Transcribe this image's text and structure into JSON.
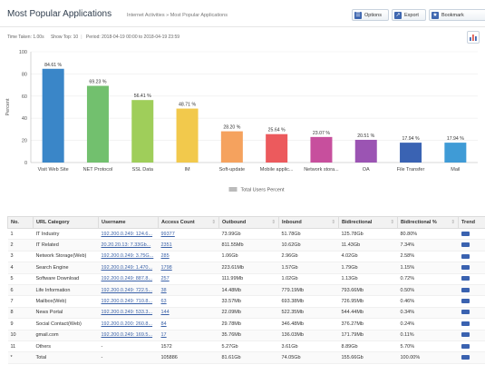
{
  "header": {
    "title": "Most Popular Applications",
    "breadcrumb": "Internet Activities » Most Popular Applications",
    "buttons": {
      "options": "Options",
      "export": "Export",
      "bookmark": "Bookmark"
    }
  },
  "info": {
    "time_taken": "Time Taken: 1.00s",
    "show_top": "Show Top: 10",
    "period": "Period: 2018-04-19 00:00 to 2018-04-19 23:59"
  },
  "chart_data": {
    "type": "bar",
    "ylabel": "Percent",
    "xlabel": "",
    "ylim": [
      0,
      100
    ],
    "yticks": [
      0,
      20,
      40,
      60,
      80,
      100
    ],
    "categories": [
      "Visit Web Site",
      "NET Protocol",
      "SSL Data",
      "IM",
      "Soft-update",
      "Mobile applic...",
      "Network stora...",
      "OA",
      "File Transfer",
      "Mail"
    ],
    "values": [
      84.61,
      69.23,
      56.41,
      48.71,
      28.2,
      25.64,
      23.07,
      20.51,
      17.94,
      17.94
    ],
    "data_labels": [
      "84.61 %",
      "69.23 %",
      "56.41 %",
      "48.71 %",
      "28.20 %",
      "25.64 %",
      "23.07 %",
      "20.51 %",
      "17.94 %",
      "17.94 %"
    ],
    "colors": [
      "#3a86c8",
      "#72c06e",
      "#9fce5a",
      "#f2c94c",
      "#f5a25e",
      "#ec5a5d",
      "#c74f9d",
      "#9b54b3",
      "#3a63b3",
      "#3f9bd6"
    ],
    "legend": [
      "Total Users Percent"
    ],
    "legend_color": "#bbbbbb",
    "grid": true
  },
  "table": {
    "columns": [
      "No.",
      "URL Category",
      "Username",
      "Access Count",
      "Outbound",
      "Inbound",
      "Bidirectional",
      "Bidirectional %",
      "Trend"
    ],
    "rows": [
      [
        "1",
        "IT Industry",
        "192.200.0.249: 124.6...",
        "99377",
        "73.99Gb",
        "51.78Gb",
        "125.78Gb",
        "80.80%"
      ],
      [
        "2",
        "IT Related",
        "20.20.20.13: 7.33Gb...",
        "2351",
        "811.55Mb",
        "10.62Gb",
        "11.43Gb",
        "7.34%"
      ],
      [
        "3",
        "Network Storage(Web)",
        "192.200.0.249: 3.75G...",
        "285",
        "1.06Gb",
        "2.96Gb",
        "4.02Gb",
        "2.58%"
      ],
      [
        "4",
        "Search Engine",
        "192.200.0.249: 1.470...",
        "1798",
        "223.61Mb",
        "1.57Gb",
        "1.79Gb",
        "1.15%"
      ],
      [
        "5",
        "Software Download",
        "192.200.0.249: 887.8...",
        "257",
        "111.99Mb",
        "1.02Gb",
        "1.13Gb",
        "0.72%"
      ],
      [
        "6",
        "Life Information",
        "192.200.0.249: 722.5...",
        "38",
        "14.48Mb",
        "779.19Mb",
        "793.66Mb",
        "0.50%"
      ],
      [
        "7",
        "Mailbox(Web)",
        "192.200.0.249: 710.8...",
        "63",
        "33.57Mb",
        "693.38Mb",
        "726.95Mb",
        "0.46%"
      ],
      [
        "8",
        "News Portal",
        "192.200.0.249: 533.3...",
        "144",
        "22.09Mb",
        "522.35Mb",
        "544.44Mb",
        "0.34%"
      ],
      [
        "9",
        "Social Contact(Web)",
        "192.200.0.200: 260.8...",
        "84",
        "29.78Mb",
        "346.48Mb",
        "376.27Mb",
        "0.24%"
      ],
      [
        "10",
        "gmail.com",
        "192.200.0.249: 169.5...",
        "17",
        "35.76Mb",
        "136.03Mb",
        "171.79Mb",
        "0.11%"
      ],
      [
        "11",
        "Others",
        "-",
        "1572",
        "5.27Gb",
        "3.61Gb",
        "8.89Gb",
        "5.70%"
      ],
      [
        "*",
        "Total",
        "-",
        "105886",
        "81.61Gb",
        "74.05Gb",
        "155.66Gb",
        "100.00%"
      ]
    ]
  }
}
